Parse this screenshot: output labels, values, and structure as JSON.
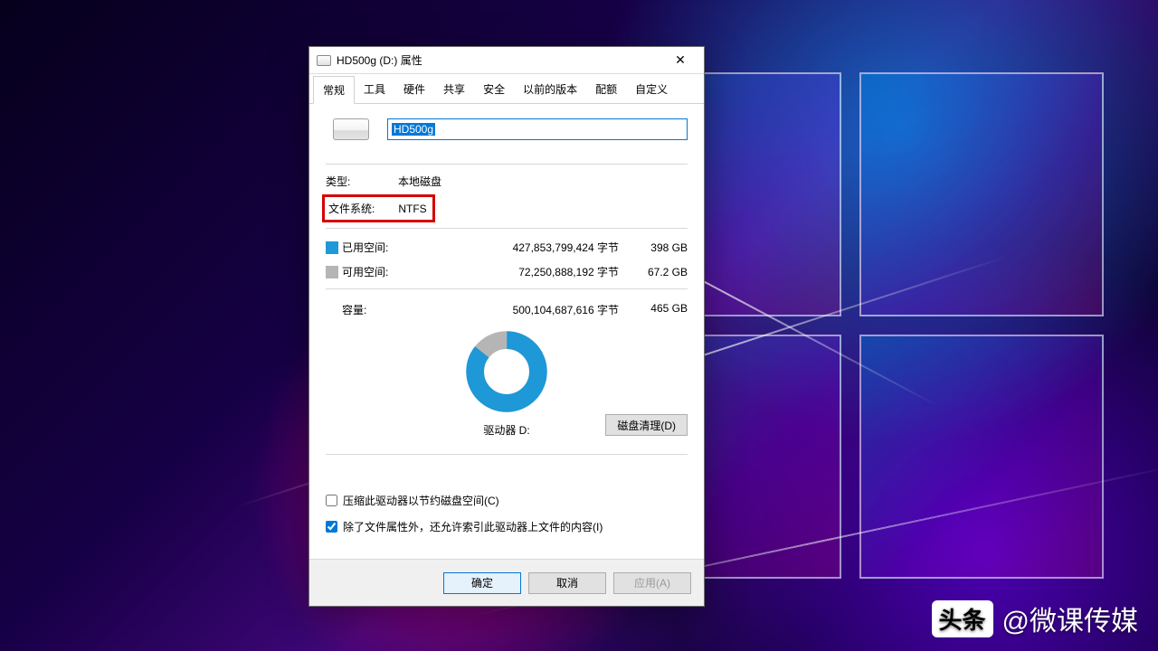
{
  "window": {
    "title": "HD500g (D:) 属性",
    "drive_name": "HD500g"
  },
  "tabs": [
    "常规",
    "工具",
    "硬件",
    "共享",
    "安全",
    "以前的版本",
    "配额",
    "自定义"
  ],
  "general": {
    "type_label": "类型:",
    "type_value": "本地磁盘",
    "fs_label": "文件系统:",
    "fs_value": "NTFS",
    "used_label": "已用空间:",
    "used_bytes": "427,853,799,424 字节",
    "used_h": "398 GB",
    "free_label": "可用空间:",
    "free_bytes": "72,250,888,192 字节",
    "free_h": "67.2 GB",
    "cap_label": "容量:",
    "cap_bytes": "500,104,687,616 字节",
    "cap_h": "465 GB",
    "drive_label": "驱动器 D:",
    "cleanup_btn": "磁盘清理(D)",
    "chk_compress": "压缩此驱动器以节约磁盘空间(C)",
    "chk_index": "除了文件属性外，还允许索引此驱动器上文件的内容(I)"
  },
  "buttons": {
    "ok": "确定",
    "cancel": "取消",
    "apply": "应用(A)"
  },
  "colors": {
    "used": "#1e98d7",
    "free": "#b5b5b5"
  },
  "chart_data": {
    "type": "pie",
    "title": "驱动器 D:",
    "series": [
      {
        "name": "已用空间",
        "value": 398,
        "unit": "GB",
        "color": "#1e98d7"
      },
      {
        "name": "可用空间",
        "value": 67.2,
        "unit": "GB",
        "color": "#b5b5b5"
      }
    ],
    "total": {
      "name": "容量",
      "value": 465,
      "unit": "GB"
    },
    "used_fraction": 0.856
  },
  "watermark": {
    "badge": "头条",
    "handle": "@微课传媒"
  }
}
